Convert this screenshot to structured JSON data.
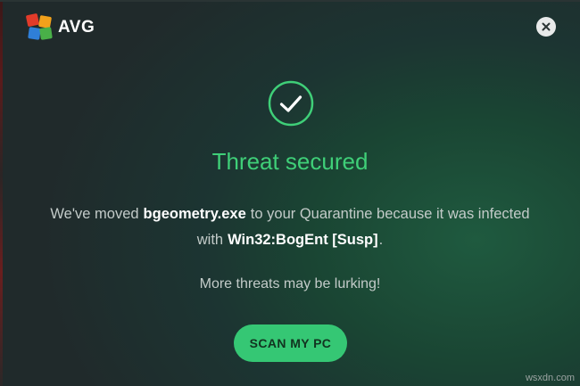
{
  "app": {
    "brand": "AVG"
  },
  "dialog": {
    "title": "Threat secured",
    "message_prefix": "We've moved",
    "file_name": "bgeometry.exe",
    "message_middle": "to your Quarantine because it was infected",
    "message_with": "with",
    "threat_name": "Win32:BogEnt [Susp]",
    "message_suffix": ".",
    "sub_message": "More threats may be lurking!",
    "scan_button_label": "SCAN MY PC"
  },
  "watermark": "wsxdn.com",
  "icons": {
    "close": "close-icon",
    "success": "checkmark-circle-icon",
    "logo": "avg-logo-icon"
  },
  "colors": {
    "accent": "#3fcf78",
    "button": "#35c774",
    "background": "#1c3532"
  }
}
